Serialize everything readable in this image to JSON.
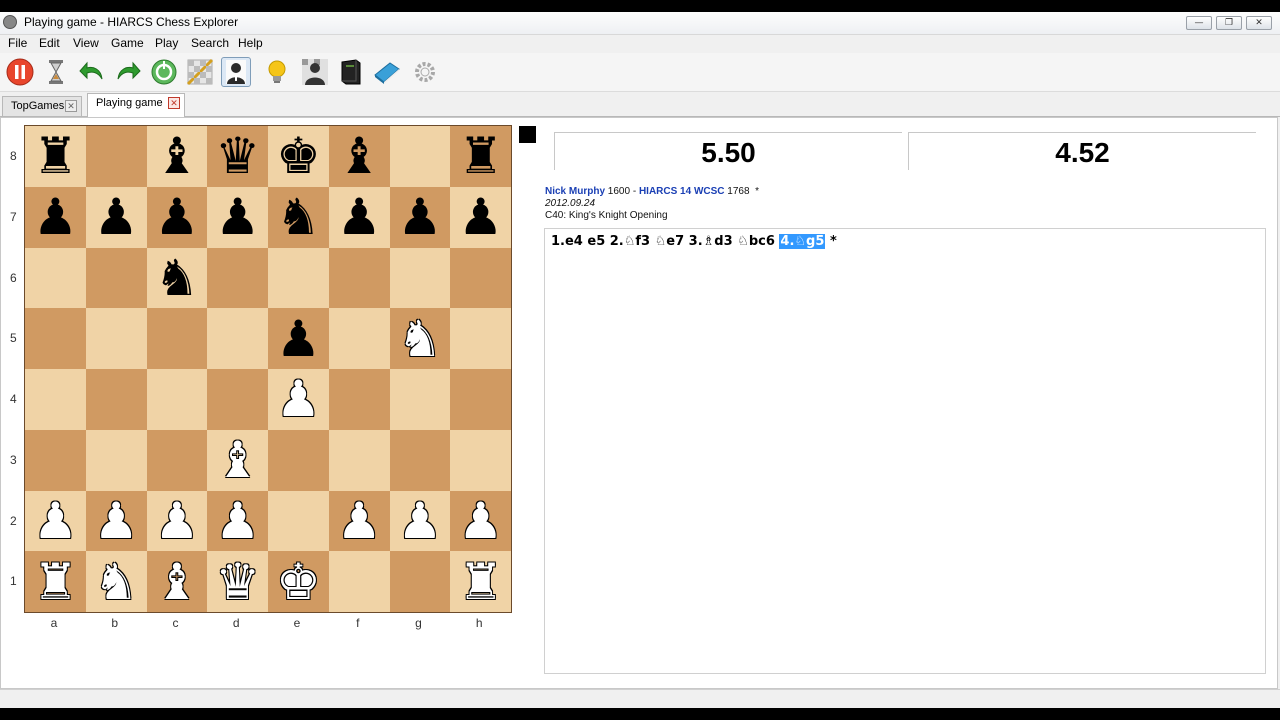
{
  "window": {
    "title": "Playing game - HIARCS Chess Explorer"
  },
  "menu": [
    "File",
    "Edit",
    "View",
    "Game",
    "Play",
    "Search",
    "Help"
  ],
  "toolbar": [
    {
      "name": "pause-icon",
      "color": "#e8452c"
    },
    {
      "name": "hourglass-icon",
      "color": "#888888"
    },
    {
      "name": "undo-icon",
      "color": "#2e9b2e"
    },
    {
      "name": "redo-icon",
      "color": "#2e9b2e"
    },
    {
      "name": "engine-icon",
      "color": "#4caf50"
    },
    {
      "name": "board-icon",
      "color": "#c0c0c0"
    },
    {
      "name": "player-icon",
      "color": "#333333"
    },
    {
      "name": "hint-icon",
      "color": "#f5c518"
    },
    {
      "name": "opponent-icon",
      "color": "#333333"
    },
    {
      "name": "book-icon",
      "color": "#222222"
    },
    {
      "name": "notebook-icon",
      "color": "#3aa0d8"
    },
    {
      "name": "settings-icon",
      "color": "#999999"
    }
  ],
  "tabs": [
    {
      "label": "TopGames",
      "active": false
    },
    {
      "label": "Playing game",
      "active": true
    }
  ],
  "board": {
    "ranks": [
      "8",
      "7",
      "6",
      "5",
      "4",
      "3",
      "2",
      "1"
    ],
    "files": [
      "a",
      "b",
      "c",
      "d",
      "e",
      "f",
      "g",
      "h"
    ],
    "rows": [
      [
        "r",
        "",
        "b",
        "q",
        "k",
        "b",
        "",
        "r"
      ],
      [
        "p",
        "p",
        "p",
        "p",
        "n",
        "p",
        "p",
        "p"
      ],
      [
        "",
        "",
        "n",
        "",
        "",
        "",
        "",
        ""
      ],
      [
        "",
        "",
        "",
        "",
        "p",
        "",
        "N",
        ""
      ],
      [
        "",
        "",
        "",
        "",
        "P",
        "",
        "",
        ""
      ],
      [
        "",
        "",
        "",
        "B",
        "",
        "",
        "",
        ""
      ],
      [
        "P",
        "P",
        "P",
        "P",
        "",
        "P",
        "P",
        "P"
      ],
      [
        "R",
        "N",
        "B",
        "Q",
        "K",
        "",
        "",
        "R"
      ]
    ]
  },
  "clocks": {
    "white": "5.50",
    "black": "4.52"
  },
  "game": {
    "white_player": "Nick Murphy",
    "white_elo": "1600",
    "separator": " - ",
    "black_player": "HIARCS 14 WCSC",
    "black_elo": "1768",
    "result": "*",
    "date": "2012.09.24",
    "opening": "C40: King's Knight Opening"
  },
  "moves": {
    "text": "1.e4 e5 2.♘f3 ♘e7 3.♗d3 ♘bc6 ",
    "highlight": "4.♘g5",
    "result": " *"
  }
}
